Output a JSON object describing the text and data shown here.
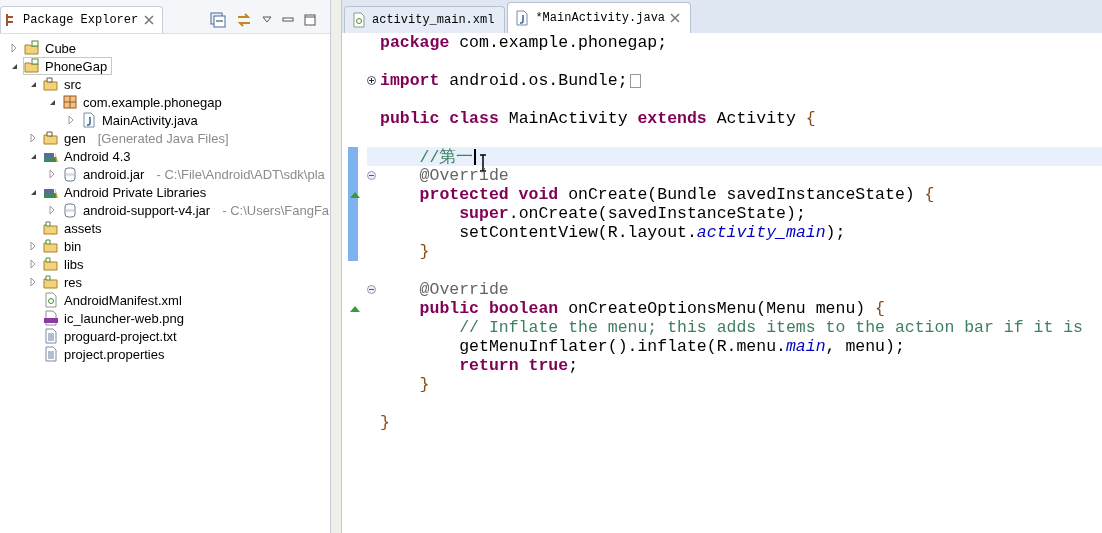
{
  "package_explorer": {
    "title": "Package Explorer",
    "tree": [
      {
        "label": "Cube",
        "kind": "project",
        "expanded": false,
        "selected": false
      },
      {
        "label": "PhoneGap",
        "kind": "project",
        "expanded": true,
        "selected": true,
        "children": [
          {
            "label": "src",
            "kind": "source_folder",
            "expanded": true,
            "selected": false,
            "children": [
              {
                "label": "com.example.phonegap",
                "kind": "package",
                "expanded": true,
                "selected": false,
                "children": [
                  {
                    "label": "MainActivity.java",
                    "kind": "java_file",
                    "expanded": false,
                    "selected": false
                  }
                ]
              }
            ]
          },
          {
            "label": "gen",
            "decoration": "[Generated Java Files]",
            "kind": "source_folder",
            "expanded": false,
            "selected": false
          },
          {
            "label": "Android 4.3",
            "kind": "library",
            "expanded": true,
            "selected": false,
            "children": [
              {
                "label": "android.jar",
                "decoration": "- C:\\File\\Android\\ADT\\sdk\\pla",
                "kind": "jar",
                "expanded": false,
                "selected": false
              }
            ]
          },
          {
            "label": "Android Private Libraries",
            "kind": "library",
            "expanded": true,
            "selected": false,
            "children": [
              {
                "label": "android-support-v4.jar",
                "decoration": "- C:\\Users\\FangFa",
                "kind": "jar",
                "expanded": false,
                "selected": false
              }
            ]
          },
          {
            "label": "assets",
            "kind": "folder",
            "selected": false
          },
          {
            "label": "bin",
            "kind": "folder",
            "expanded": false,
            "selected": false
          },
          {
            "label": "libs",
            "kind": "folder",
            "expanded": false,
            "selected": false
          },
          {
            "label": "res",
            "kind": "folder",
            "expanded": false,
            "selected": false
          },
          {
            "label": "AndroidManifest.xml",
            "kind": "xml_file",
            "selected": false
          },
          {
            "label": "ic_launcher-web.png",
            "kind": "image_file",
            "selected": false
          },
          {
            "label": "proguard-project.txt",
            "kind": "text_file",
            "selected": false
          },
          {
            "label": "project.properties",
            "kind": "text_file",
            "selected": false
          }
        ]
      }
    ]
  },
  "editor": {
    "tabs": [
      {
        "label": "activity_main.xml",
        "kind": "xml_file",
        "selected": false
      },
      {
        "label": "*MainActivity.java",
        "kind": "java_file",
        "selected": true
      }
    ],
    "lines": [
      {
        "kind": "code",
        "tokens": [
          {
            "kind": "keyword",
            "text": "package"
          },
          {
            "kind": "plain",
            "text": " com.example.phonegap;"
          }
        ]
      },
      {
        "kind": "blank"
      },
      {
        "kind": "code",
        "collapsed": true,
        "tokens": [
          {
            "kind": "keyword",
            "text": "import"
          },
          {
            "kind": "plain",
            "text": " android.os.Bundle;"
          }
        ]
      },
      {
        "kind": "blank"
      },
      {
        "kind": "code",
        "tokens": [
          {
            "kind": "keyword",
            "text": "public class"
          },
          {
            "kind": "plain",
            "text": " MainActivity "
          },
          {
            "kind": "keyword",
            "text": "extends"
          },
          {
            "kind": "plain",
            "text": " Activity "
          },
          {
            "kind": "brace",
            "text": "{"
          }
        ]
      },
      {
        "kind": "blank"
      },
      {
        "kind": "code",
        "current": true,
        "changed": true,
        "tokens": [
          {
            "kind": "comment",
            "text": "    //第一"
          }
        ]
      },
      {
        "kind": "code",
        "collapsed": false,
        "changed": true,
        "tokens": [
          {
            "kind": "annotation",
            "text": "    @Override"
          }
        ]
      },
      {
        "kind": "code",
        "override": true,
        "changed": true,
        "tokens": [
          {
            "kind": "keyword",
            "text": "    protected void"
          },
          {
            "kind": "plain",
            "text": " onCreate(Bundle savedInstanceState) "
          },
          {
            "kind": "brace",
            "text": "{"
          }
        ]
      },
      {
        "kind": "code",
        "changed": true,
        "tokens": [
          {
            "kind": "keyword",
            "text": "        super"
          },
          {
            "kind": "plain",
            "text": ".onCreate(savedInstanceState);"
          }
        ]
      },
      {
        "kind": "code",
        "changed": true,
        "tokens": [
          {
            "kind": "plain",
            "text": "        setContentView(R.layout."
          },
          {
            "kind": "field",
            "text": "activity_main"
          },
          {
            "kind": "plain",
            "text": ");"
          }
        ]
      },
      {
        "kind": "code",
        "changed": true,
        "tokens": [
          {
            "kind": "brace",
            "text": "    }"
          }
        ]
      },
      {
        "kind": "blank"
      },
      {
        "kind": "code",
        "collapsed": false,
        "tokens": [
          {
            "kind": "annotation",
            "text": "    @Override"
          }
        ]
      },
      {
        "kind": "code",
        "override": true,
        "tokens": [
          {
            "kind": "keyword",
            "text": "    public boolean"
          },
          {
            "kind": "plain",
            "text": " onCreateOptionsMenu(Menu menu) "
          },
          {
            "kind": "brace",
            "text": "{"
          }
        ]
      },
      {
        "kind": "code",
        "tokens": [
          {
            "kind": "comment",
            "text": "        // Inflate the menu; this adds items to the action bar if it is"
          }
        ]
      },
      {
        "kind": "code",
        "tokens": [
          {
            "kind": "plain",
            "text": "        getMenuInflater().inflate(R.menu."
          },
          {
            "kind": "field",
            "text": "main"
          },
          {
            "kind": "plain",
            "text": ", menu);"
          }
        ]
      },
      {
        "kind": "code",
        "tokens": [
          {
            "kind": "keyword",
            "text": "        return true"
          },
          {
            "kind": "plain",
            "text": ";"
          }
        ]
      },
      {
        "kind": "code",
        "tokens": [
          {
            "kind": "brace",
            "text": "    }"
          }
        ]
      },
      {
        "kind": "blank"
      },
      {
        "kind": "code",
        "tokens": [
          {
            "kind": "brace",
            "text": "}"
          }
        ]
      }
    ]
  }
}
